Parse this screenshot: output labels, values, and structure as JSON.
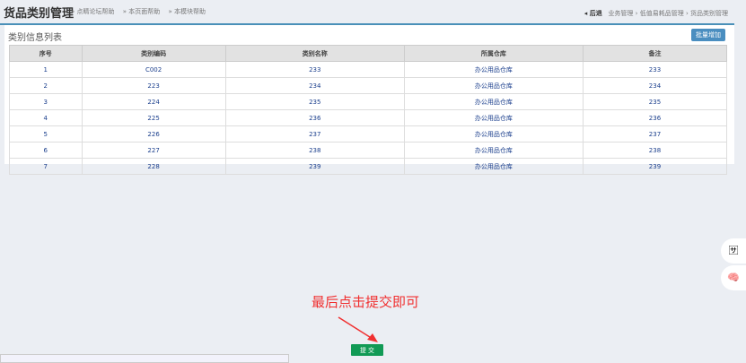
{
  "header": {
    "title": "货品类别管理",
    "help": [
      "» 点睛论坛帮助",
      "» 本页面帮助",
      "» 本模块帮助"
    ],
    "back": "◂ 后退",
    "breadcrumb": [
      "业务管理",
      "›",
      "低值易耗品管理",
      "›",
      "货品类别管理"
    ]
  },
  "panel": {
    "title": "类别信息列表",
    "batch_add": "批量增加"
  },
  "table": {
    "columns": [
      "序号",
      "类别编码",
      "类别名称",
      "所属仓库",
      "备注"
    ],
    "rows": [
      [
        "1",
        "C002",
        "233",
        "办公用品仓库",
        "233"
      ],
      [
        "2",
        "223",
        "234",
        "办公用品仓库",
        "234"
      ],
      [
        "3",
        "224",
        "235",
        "办公用品仓库",
        "235"
      ],
      [
        "4",
        "225",
        "236",
        "办公用品仓库",
        "236"
      ],
      [
        "5",
        "226",
        "237",
        "办公用品仓库",
        "237"
      ],
      [
        "6",
        "227",
        "238",
        "办公用品仓库",
        "238"
      ],
      [
        "7",
        "228",
        "239",
        "办公用品仓库",
        "239"
      ]
    ]
  },
  "annotation": "最后点击提交即可",
  "submit": "提 交",
  "colors": {
    "accent": "#4a90b8",
    "submit": "#119a55",
    "annotation": "#f03030"
  }
}
